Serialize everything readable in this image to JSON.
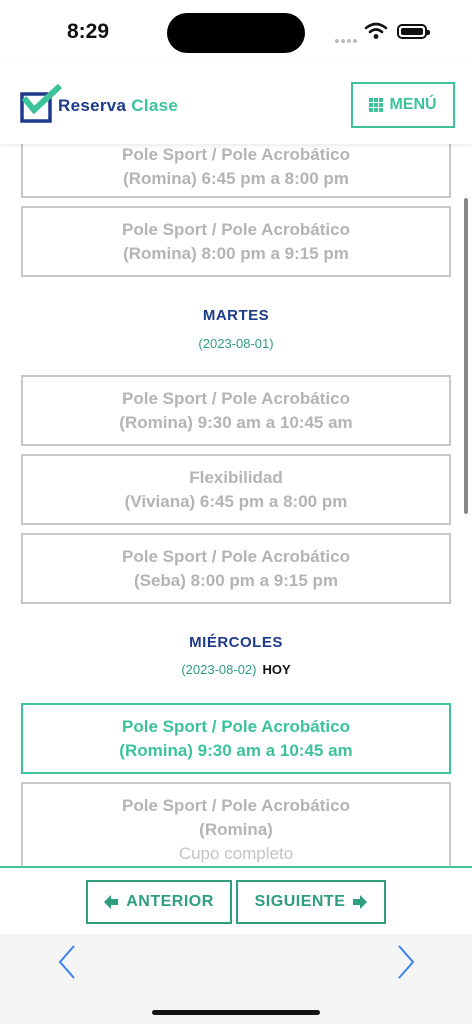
{
  "status_bar": {
    "time": "8:29"
  },
  "header": {
    "brand_primary": "Reserva",
    "brand_secondary": "Clase",
    "menu_label": "MENÚ"
  },
  "slots_top": [
    {
      "line1": "Pole Sport / Pole Acrobático",
      "line2": "(Romina) 6:45 pm a 8:00 pm"
    },
    {
      "line1": "Pole Sport / Pole Acrobático",
      "line2": "(Romina) 8:00 pm a 9:15 pm"
    }
  ],
  "days": [
    {
      "name": "MARTES",
      "date": "(2023-08-01)",
      "slots": [
        {
          "line1": "Pole Sport / Pole Acrobático",
          "line2": "(Romina) 9:30 am a 10:45 am"
        },
        {
          "line1": "Flexibilidad",
          "line2": "(Viviana) 6:45 pm a 8:00 pm"
        },
        {
          "line1": "Pole Sport / Pole Acrobático",
          "line2": "(Seba) 8:00 pm a 9:15 pm"
        }
      ]
    },
    {
      "name": "MIÉRCOLES",
      "date": "(2023-08-02)",
      "today_label": "HOY",
      "slots": [
        {
          "line1": "Pole Sport / Pole Acrobático",
          "line2": "(Romina) 9:30 am a 10:45 am"
        },
        {
          "line1": "Pole Sport / Pole Acrobático",
          "line2": "(Romina)",
          "note": "Cupo completo"
        }
      ]
    }
  ],
  "nav": {
    "prev_label": "ANTERIOR",
    "next_label": "SIGUIENTE"
  },
  "colors": {
    "primary": "#1e3a8a",
    "accent": "#3cc39a",
    "muted": "#b4b4b4"
  },
  "icons": [
    "wifi-icon",
    "battery-icon",
    "checkbox-logo-icon",
    "grid-icon",
    "arrow-left-icon",
    "arrow-right-icon",
    "chevron-left-icon",
    "chevron-right-icon"
  ]
}
